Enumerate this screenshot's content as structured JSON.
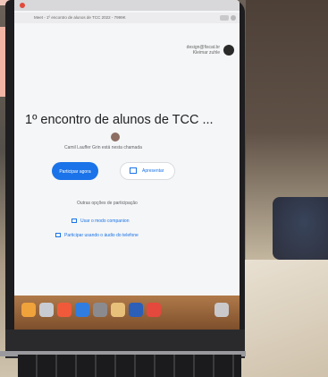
{
  "browser": {
    "tab_text": "Meet - 1º encontro de alunos de TCC 2022 - 7999K",
    "account_email": "design@fiscat.br",
    "account_name": "Kleimar zuhle"
  },
  "meeting": {
    "title": "1º encontro de alunos de TCC ...",
    "presence_text": "Camil Lauffer Grin está nesta chamada",
    "join_label": "Participar agora",
    "present_label": "Apresentar",
    "other_options_label": "Outras opções de participação",
    "option_companion": "Usar o modo companion",
    "option_phone": "Participar usando o áudio do telefone"
  },
  "dock": {
    "apps": [
      {
        "icon": "finder-icon",
        "color": "#f0a23b"
      },
      {
        "icon": "launchpad-icon",
        "color": "#c9cbd2"
      },
      {
        "icon": "photos-icon",
        "color": "#f05a3a"
      },
      {
        "icon": "app-store-icon",
        "color": "#2f7de1"
      },
      {
        "icon": "settings-icon",
        "color": "#8b8b8f"
      },
      {
        "icon": "preview-icon",
        "color": "#e8c07a"
      },
      {
        "icon": "word-icon",
        "color": "#2b5fb8"
      },
      {
        "icon": "chrome-icon",
        "color": "#e5483c"
      },
      {
        "icon": "trash-icon",
        "color": "#c9c9cc"
      }
    ]
  }
}
